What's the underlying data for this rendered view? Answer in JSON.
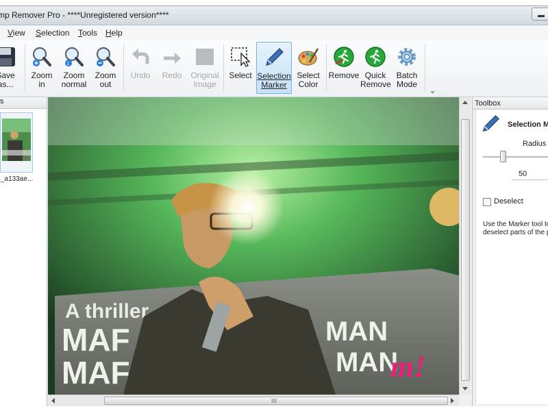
{
  "window": {
    "title": "mp Remover Pro - ****Unregistered version****"
  },
  "menu": {
    "items": [
      {
        "label": "View",
        "accel": "V"
      },
      {
        "label": "Selection",
        "accel": "S"
      },
      {
        "label": "Tools",
        "accel": "T"
      },
      {
        "label": "Help",
        "accel": "H"
      }
    ]
  },
  "toolbar": {
    "save": {
      "line1": "Save",
      "line2": "as..."
    },
    "zoom_in": {
      "line1": "Zoom",
      "line2": "in"
    },
    "zoom_normal": {
      "line1": "Zoom",
      "line2": "normal"
    },
    "zoom_out": {
      "line1": "Zoom",
      "line2": "out"
    },
    "undo": {
      "line1": "Undo",
      "line2": ""
    },
    "redo": {
      "line1": "Redo",
      "line2": ""
    },
    "original": {
      "line1": "Original",
      "line2": "Image"
    },
    "select": {
      "line1": "Select",
      "line2": ""
    },
    "selection_marker": {
      "line1": "Selection",
      "line2": "Marker"
    },
    "select_color": {
      "line1": "Select",
      "line2": "Color"
    },
    "remove": {
      "line1": "Remove",
      "line2": ""
    },
    "quick_remove": {
      "line1": "Quick",
      "line2": "Remove"
    },
    "batch_mode": {
      "line1": "Batch",
      "line2": "Mode"
    }
  },
  "files_panel": {
    "header": "s",
    "thumbnail_name": "_a133ae..."
  },
  "canvas": {
    "banner_text": "A thriller",
    "names_line1": "MAF",
    "names_line2": "MAF",
    "names_right1": "MAN",
    "names_right2": "MAN",
    "watermark": "m!"
  },
  "toolbox": {
    "header": "Toolbox",
    "tool_title": "Selection M",
    "radius_label": "Radius",
    "radius_value": "50",
    "radius_level": 0.28,
    "deselect_label": "Deselect",
    "deselect_checked": false,
    "help_line1": "Use the Marker tool to",
    "help_line2": "deselect parts of the p"
  },
  "colors": {
    "accent": "#78aedc",
    "canvas_green": "#3f9a46",
    "watermark": "#e8207a"
  }
}
